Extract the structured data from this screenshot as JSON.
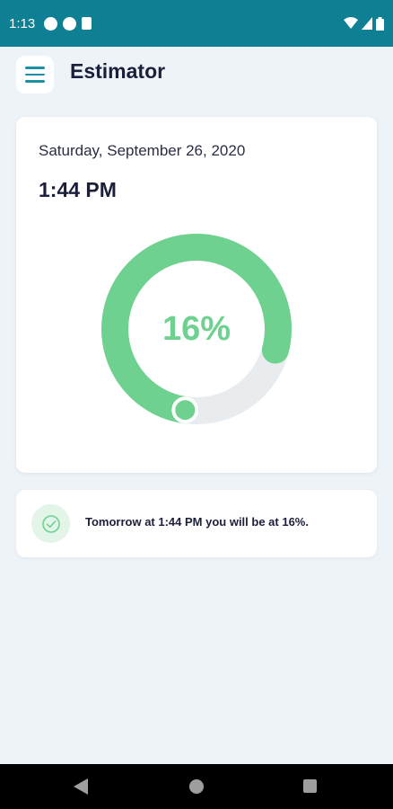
{
  "status_bar": {
    "time": "1:13",
    "icons": [
      "notification-a-icon",
      "notification-p-icon",
      "sd-card-icon",
      "wifi-icon",
      "signal-icon",
      "battery-icon"
    ]
  },
  "app_bar": {
    "title": "Estimator",
    "menu_icon": "hamburger-menu-icon"
  },
  "estimate_card": {
    "date": "Saturday, September 26, 2020",
    "time": "1:44 PM",
    "percentage_label": "16%",
    "progress_percent": 16,
    "progress_color": "#6fd18f",
    "track_color": "#e8ecef",
    "percent_text_color": "#6fd18f"
  },
  "info_card": {
    "icon": "check-circle-icon",
    "text": "Tomorrow at 1:44 PM you will be at 16%."
  },
  "nav_bar": {
    "icons": [
      "back-icon",
      "home-icon",
      "recents-icon"
    ]
  },
  "colors": {
    "status_bar": "#0f7f93",
    "accent": "#1c8fa6",
    "background": "#eef3f8"
  }
}
